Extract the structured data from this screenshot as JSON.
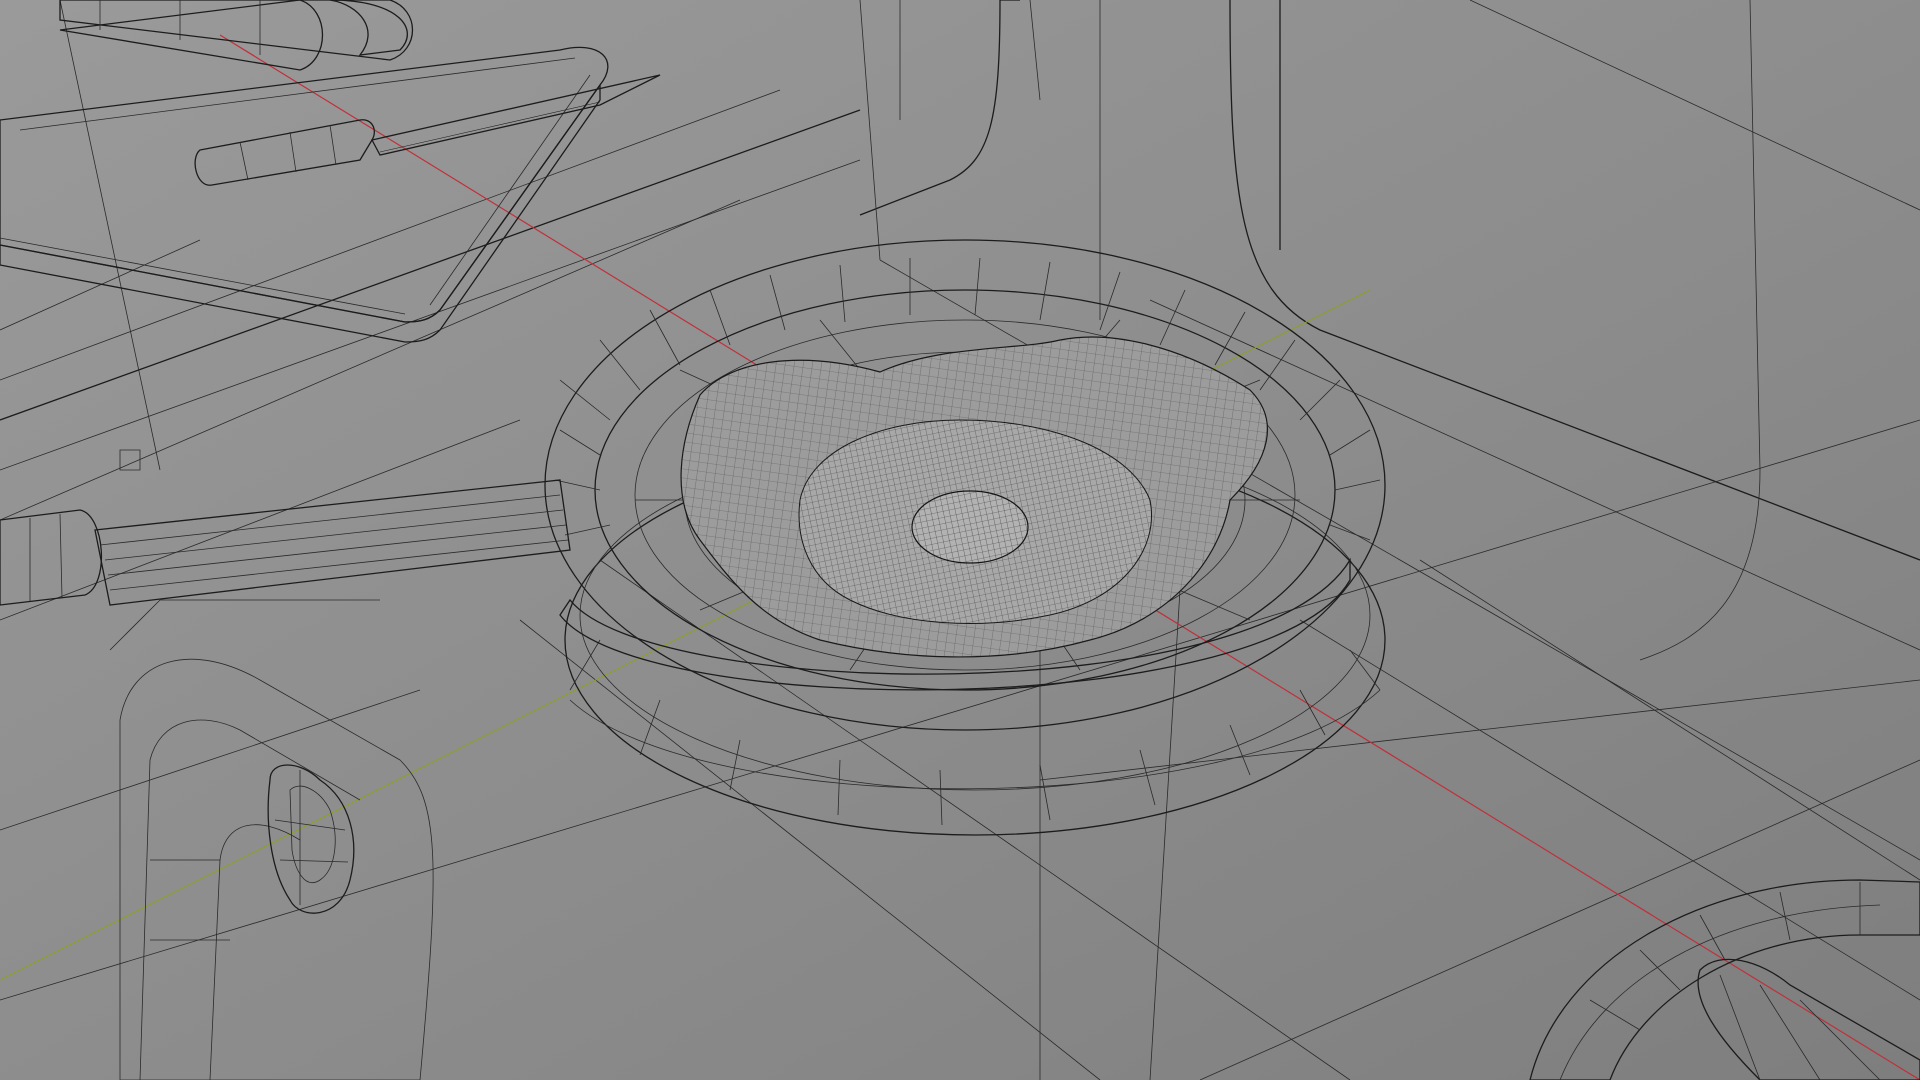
{
  "viewport": {
    "mode": "wireframe-overlay",
    "scene_objects": [
      "frying-pan",
      "fried-egg",
      "stove-burner",
      "cutting-board",
      "knife",
      "rolling-pin",
      "stove-knob",
      "faucet"
    ],
    "colors": {
      "background": "#8f8f8f",
      "wire": "#1c1c1c",
      "x_axis": "#c0303a",
      "y_axis": "#8aa02a"
    }
  }
}
